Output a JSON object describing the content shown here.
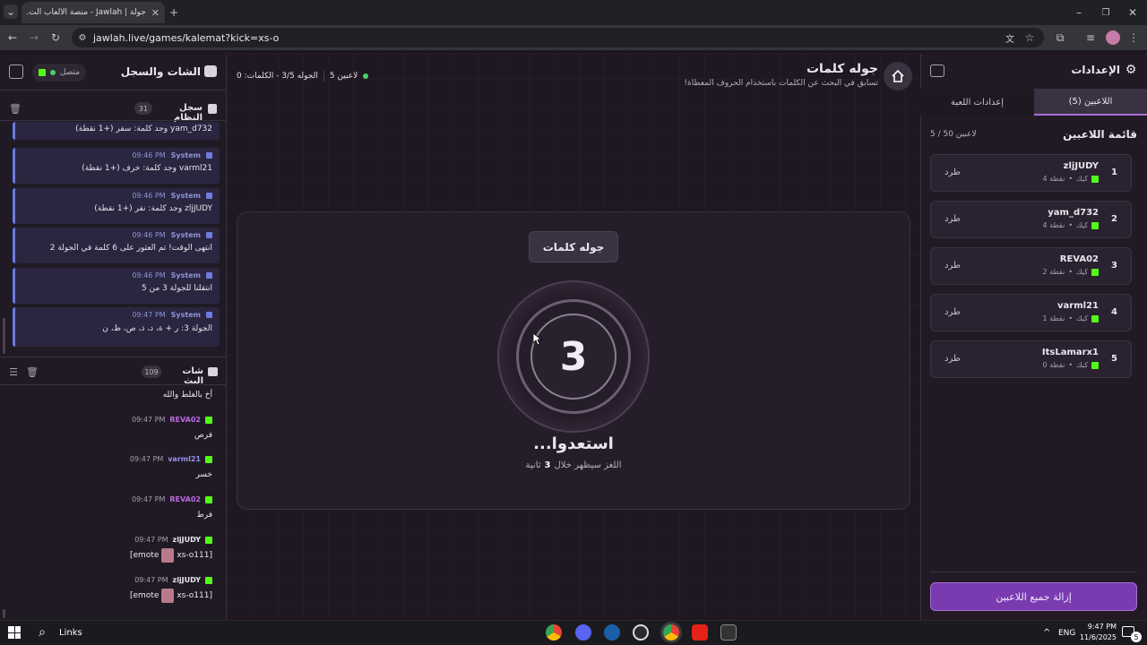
{
  "browser": {
    "tab_title": "جولة | Jawlah - منصة الألعاب الت...",
    "url": "jawlah.live/games/kalemat?kick=xs-o"
  },
  "chat_panel": {
    "title": "الشات والسجل",
    "status": "متصل",
    "system_log": {
      "title": "سجل النظام",
      "count": "31",
      "messages": [
        {
          "text": "yam_d732 وجد كلمة: سفر (+1 نقطة)"
        },
        {
          "sender": "System",
          "time": "09:46 PM",
          "text": "varml21 وجد كلمة: خرف (+1 نقطة)"
        },
        {
          "sender": "System",
          "time": "09:46 PM",
          "text": "zljJUDY وجد كلمة: نفر (+1 نقطة)"
        },
        {
          "sender": "System",
          "time": "09:46 PM",
          "text": "انتهى الوقت! تم العثور على 6 كلمة في الجولة 2"
        },
        {
          "sender": "System",
          "time": "09:46 PM",
          "text": "انتقلنا للجولة 3 من 5"
        },
        {
          "sender": "System",
          "time": "09:47 PM",
          "text": "الجولة 3: ر + ة، د، ذ، ص، ظ، ن"
        }
      ]
    },
    "live_chat": {
      "title": "شات البث",
      "count": "109",
      "first_text": "أخ بالغلط والله",
      "messages": [
        {
          "user": "REVA02",
          "time": "09:47 PM",
          "text": "فرص",
          "color": "#b76be0"
        },
        {
          "user": "varml21",
          "time": "09:47 PM",
          "text": "خسر",
          "color": "#9a8fe8"
        },
        {
          "user": "REVA02",
          "time": "09:47 PM",
          "text": "فرط",
          "color": "#b76be0"
        },
        {
          "user": "zljJUDY",
          "time": "09:47 PM",
          "text_left": "[emote",
          "text_right": "xs-o111]",
          "color": "#e8e6ef"
        },
        {
          "user": "zljJUDY",
          "time": "09:47 PM",
          "text_left": "[emote",
          "text_right": "xs-o111]",
          "color": "#e8e6ef"
        }
      ]
    }
  },
  "game": {
    "title": "جوله كلمات",
    "subtitle": "تسابق في البحث عن الكلمات باستخدام الحروف المعطاة!",
    "players_online": "5 لاعبين",
    "round_info": "الجوله 3/5 - الكلمات: 0",
    "badge": "جوله كلمات",
    "countdown": "3",
    "ready_text": "استعدوا...",
    "hint_prefix": "اللغز سيظهر خلال",
    "hint_number": "3",
    "hint_suffix": "ثانية"
  },
  "settings": {
    "title": "الإعدادات",
    "tab_players": "اللاعبين (5)",
    "tab_game": "إعدادات اللعبة",
    "list_title": "قائمة اللاعبين",
    "list_count": "5 / 50 لاعبين",
    "kick_label": "طرد",
    "players": [
      {
        "rank": "1",
        "name": "zljJUDY",
        "platform": "كيك",
        "points": "4 نقطة"
      },
      {
        "rank": "2",
        "name": "yam_d732",
        "platform": "كيك",
        "points": "4 نقطة"
      },
      {
        "rank": "3",
        "name": "REVA02",
        "platform": "كيك",
        "points": "2 نقطة"
      },
      {
        "rank": "4",
        "name": "varml21",
        "platform": "كيك",
        "points": "1 نقطة"
      },
      {
        "rank": "5",
        "name": "ItsLamarx1",
        "platform": "كيك",
        "points": "0 نقطة"
      }
    ],
    "remove_all": "إزالة جميع اللاعبين"
  },
  "taskbar": {
    "links": "Links",
    "lang": "ENG",
    "time": "9:47 PM",
    "date": "11/6/2025",
    "notif": "5"
  },
  "colors": {
    "accent_purple": "#7a3bb0",
    "kick_green": "#53fc18",
    "system_blue": "#6d7be0"
  }
}
